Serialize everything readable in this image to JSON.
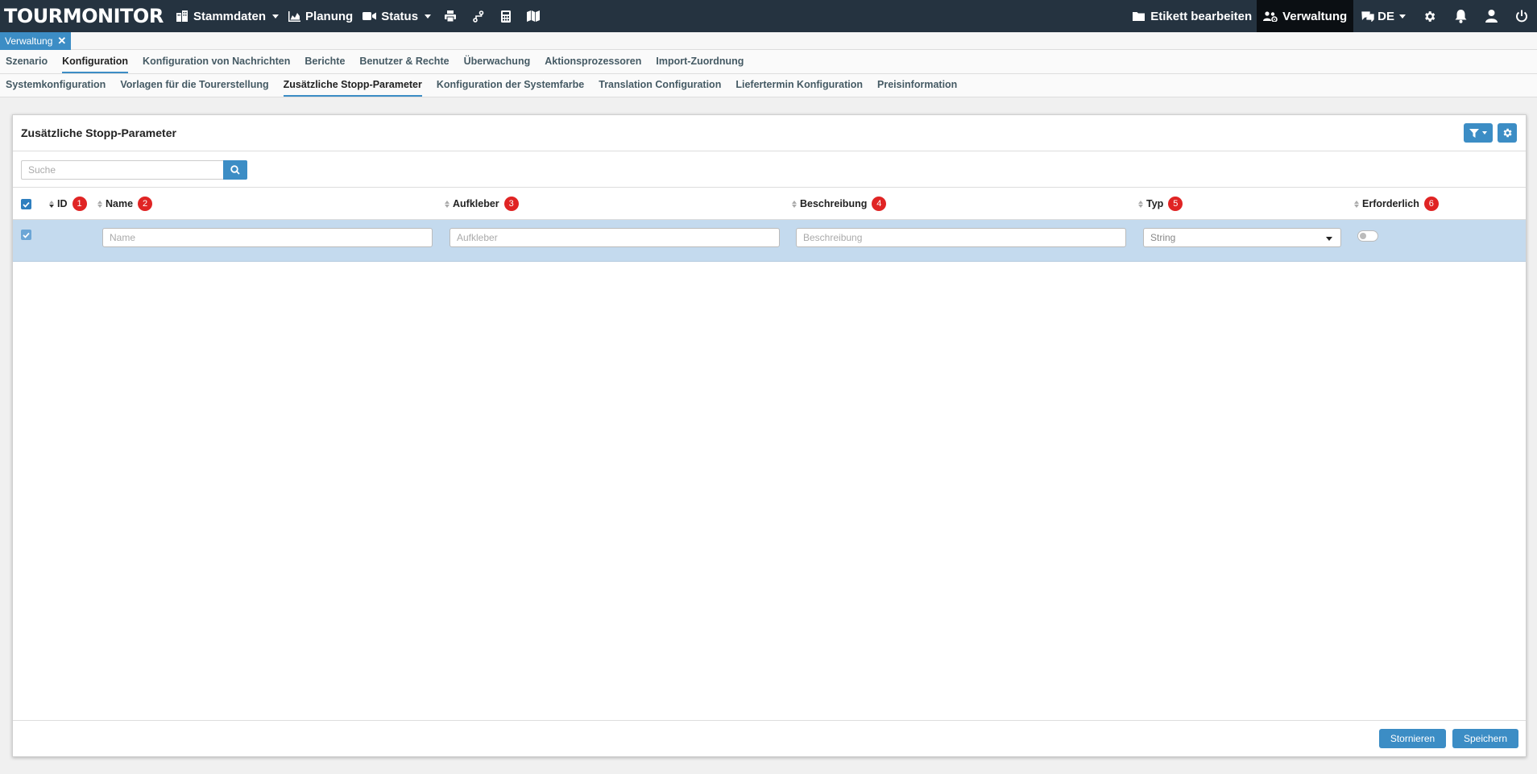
{
  "app": {
    "logo": "TOURMONITOR"
  },
  "topnav": {
    "left": [
      {
        "label": "Stammdaten",
        "icon": "building-icon",
        "dropdown": true
      },
      {
        "label": "Planung",
        "icon": "chart-area-icon",
        "dropdown": false
      },
      {
        "label": "Status",
        "icon": "video-icon",
        "dropdown": true
      }
    ],
    "icons": [
      "print-icon",
      "route-icon",
      "calculator-icon",
      "map-icon"
    ],
    "etikett_label": "Etikett bearbeiten",
    "verwaltung_label": "Verwaltung",
    "language_label": "DE"
  },
  "open_tab": {
    "label": "Verwaltung"
  },
  "menu_primary": [
    {
      "label": "Szenario",
      "active": false
    },
    {
      "label": "Konfiguration",
      "active": true
    },
    {
      "label": "Konfiguration von Nachrichten",
      "active": false
    },
    {
      "label": "Berichte",
      "active": false
    },
    {
      "label": "Benutzer & Rechte",
      "active": false
    },
    {
      "label": "Überwachung",
      "active": false
    },
    {
      "label": "Aktionsprozessoren",
      "active": false
    },
    {
      "label": "Import-Zuordnung",
      "active": false
    }
  ],
  "menu_secondary": [
    {
      "label": "Systemkonfiguration",
      "active": false
    },
    {
      "label": "Vorlagen für die Tourerstellung",
      "active": false
    },
    {
      "label": "Zusätzliche Stopp-Parameter",
      "active": true
    },
    {
      "label": "Konfiguration der Systemfarbe",
      "active": false
    },
    {
      "label": "Translation Configuration",
      "active": false
    },
    {
      "label": "Liefertermin Konfiguration",
      "active": false
    },
    {
      "label": "Preisinformation",
      "active": false
    }
  ],
  "panel": {
    "title": "Zusätzliche Stopp-Parameter",
    "search_placeholder": "Suche"
  },
  "table": {
    "columns": [
      {
        "label": "ID",
        "badge": "1"
      },
      {
        "label": "Name",
        "badge": "2"
      },
      {
        "label": "Aufkleber",
        "badge": "3"
      },
      {
        "label": "Beschreibung",
        "badge": "4"
      },
      {
        "label": "Typ",
        "badge": "5"
      },
      {
        "label": "Erforderlich",
        "badge": "6"
      }
    ],
    "edit_row": {
      "name_placeholder": "Name",
      "aufkleber_placeholder": "Aufkleber",
      "beschreibung_placeholder": "Beschreibung",
      "typ_value": "String",
      "erforderlich": false
    }
  },
  "footer": {
    "cancel_label": "Stornieren",
    "save_label": "Speichern"
  },
  "colors": {
    "navbar": "#253340",
    "accent": "#3c8dc5",
    "row_selected": "#c4daee",
    "badge": "#e02424"
  }
}
